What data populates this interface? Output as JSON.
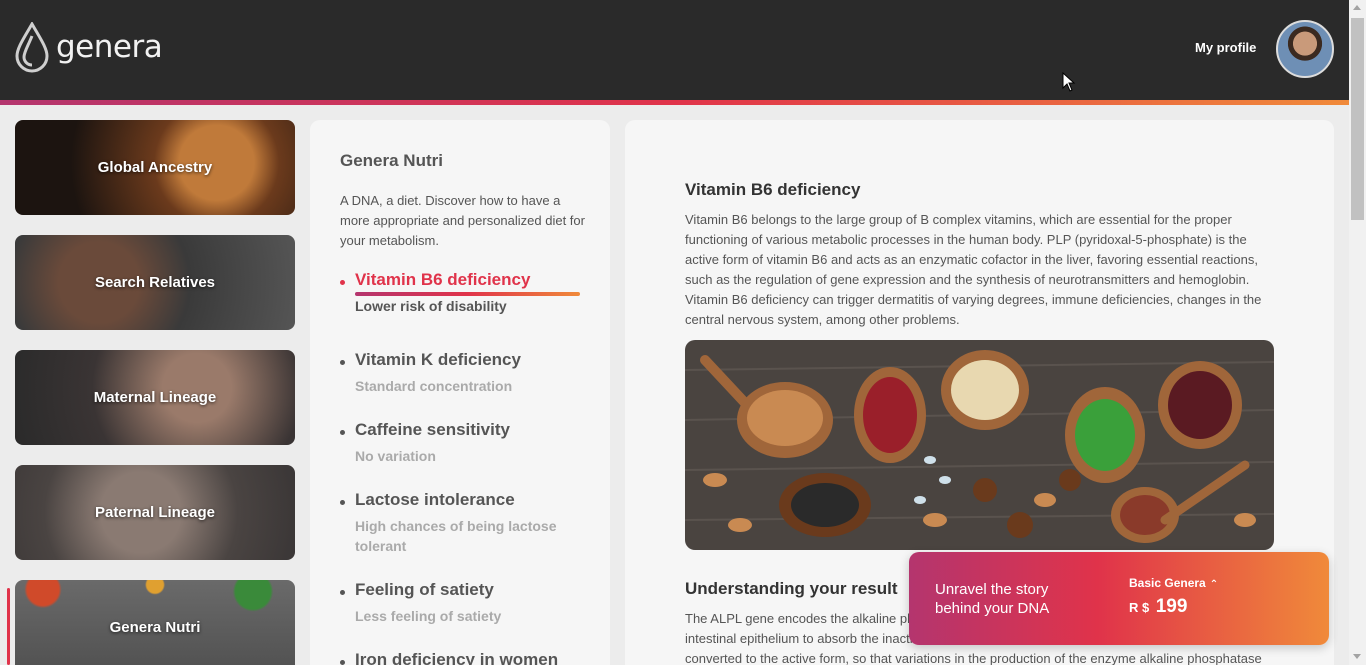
{
  "header": {
    "logo_text": "genera",
    "profile_label": "My profile"
  },
  "sidebar": {
    "items": [
      {
        "label": "Global Ancestry"
      },
      {
        "label": "Search Relatives"
      },
      {
        "label": "Maternal Lineage"
      },
      {
        "label": "Paternal Lineage"
      },
      {
        "label": "Genera Nutri"
      }
    ],
    "active_index": 4
  },
  "nutri": {
    "title": "Genera Nutri",
    "description": "A DNA, a diet. Discover how to have a more appropriate and personalized diet for your metabolism.",
    "traits": [
      {
        "name": "Vitamin B6 deficiency",
        "result": "Lower risk of disability"
      },
      {
        "name": "Vitamin K deficiency",
        "result": "Standard concentration"
      },
      {
        "name": "Caffeine sensitivity",
        "result": "No variation"
      },
      {
        "name": "Lactose intolerance",
        "result": "High chances of being lactose tolerant"
      },
      {
        "name": "Feeling of satiety",
        "result": "Less feeling of satiety"
      },
      {
        "name": "Iron deficiency in women",
        "result": ""
      }
    ]
  },
  "article": {
    "title": "Vitamin B6 deficiency",
    "body": "Vitamin B6 belongs to the large group of B complex vitamins, which are essential for the proper functioning of various metabolic processes in the human body. PLP (pyridoxal-5-phosphate) is the active form of vitamin B6 and acts as an enzymatic cofactor in the liver, favoring essential reactions, such as the regulation of gene expression and the synthesis of neurotransmitters and hemoglobin. Vitamin B6 deficiency can trigger dermatitis of varying degrees, immune deficiencies, changes in the central nervous system, among other problems.",
    "section_title": "Understanding your result",
    "section_body": "The ALPL gene encodes the alkaline phosphatase enzyme, which is necessary for the cells of the intestinal epithelium to absorb the inactive form of vitamin B6 from food. Once absorbed, it is converted to the active form, so that variations in the production of the enzyme alkaline phosphatase have a"
  },
  "promo": {
    "text": "Unravel the story behind your DNA",
    "plan": "Basic Genera",
    "currency": "R $",
    "price": "199"
  },
  "colors": {
    "accent_red": "#e0334a",
    "accent_pink": "#b4356e",
    "accent_orange": "#f08a3a",
    "header_bg": "#2a2a2a"
  }
}
